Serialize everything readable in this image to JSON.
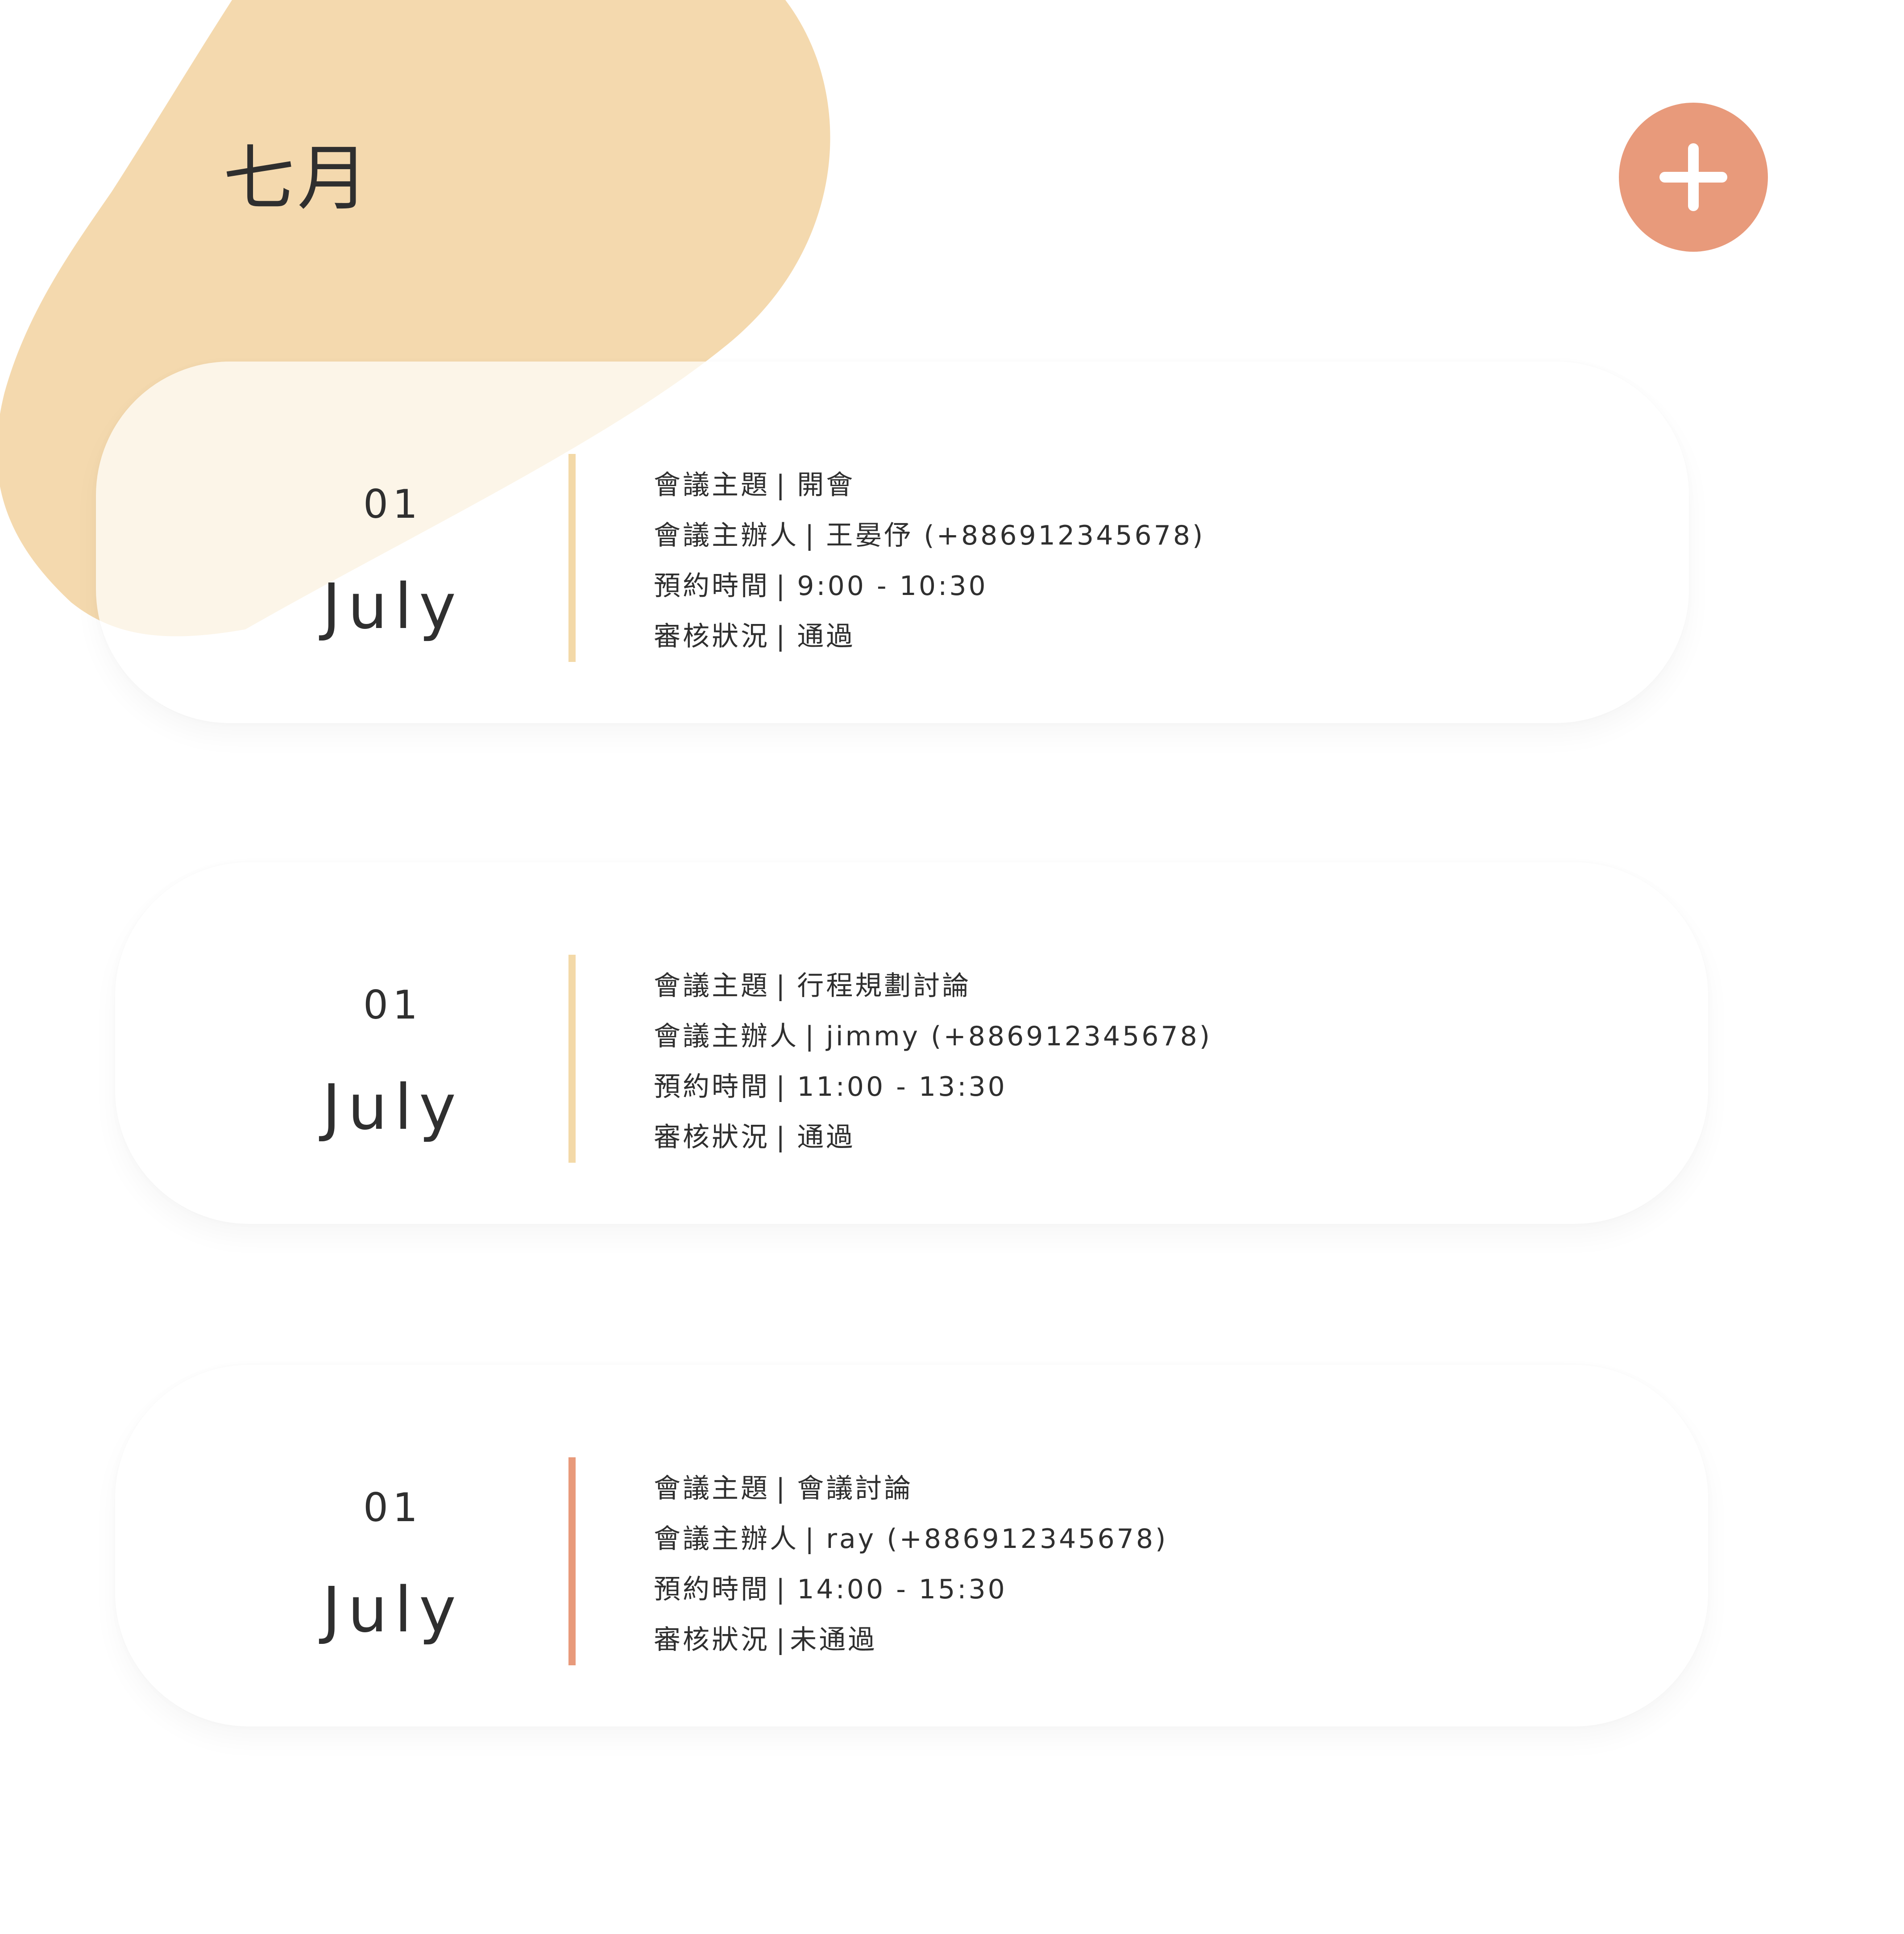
{
  "header": {
    "title": "七月",
    "add_icon": "plus-icon"
  },
  "colors": {
    "blob": "#f4d9ae",
    "add_button": "#e89a7b",
    "approved_bar": "#f3d9a8",
    "rejected_bar": "#e89a7b",
    "text": "#2f2f2f"
  },
  "meetings": [
    {
      "day": "01",
      "month": "July",
      "topic_label": "會議主題",
      "topic": "開會",
      "host_label": "會議主辦人",
      "host": "王晏伃 (+886912345678)",
      "time_label": "預約時間",
      "time": "9:00 - 10:30",
      "status_label": "審核狀況",
      "status": "通過"
    },
    {
      "day": "01",
      "month": "July",
      "topic_label": "會議主題",
      "topic": "行程規劃討論",
      "host_label": "會議主辦人",
      "host": "jimmy (+886912345678)",
      "time_label": "預約時間",
      "time": "11:00 - 13:30",
      "status_label": "審核狀況",
      "status": "通過"
    },
    {
      "day": "01",
      "month": "July",
      "topic_label": "會議主題",
      "topic": "會議討論",
      "host_label": "會議主辦人",
      "host": "ray (+886912345678)",
      "time_label": "預約時間",
      "time": "14:00 - 15:30",
      "status_label": "審核狀況",
      "status": "未通過"
    }
  ]
}
